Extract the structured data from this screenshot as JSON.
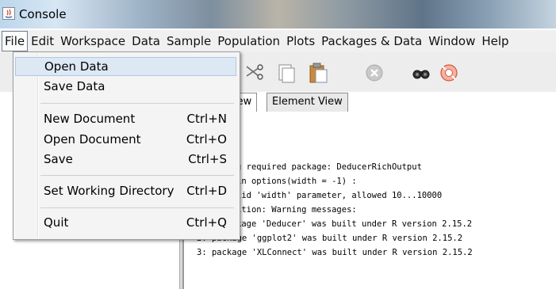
{
  "window": {
    "title": "Console"
  },
  "menubar": {
    "items": [
      "File",
      "Edit",
      "Workspace",
      "Data",
      "Sample",
      "Population",
      "Plots",
      "Packages & Data",
      "Window",
      "Help"
    ]
  },
  "file_menu": {
    "items": [
      {
        "label": "Open Data",
        "shortcut": ""
      },
      {
        "label": "Save Data",
        "shortcut": ""
      },
      {
        "label": "New Document",
        "shortcut": "Ctrl+N"
      },
      {
        "label": "Open Document",
        "shortcut": "Ctrl+O"
      },
      {
        "label": "Save",
        "shortcut": "Ctrl+S"
      },
      {
        "label": "Set Working Directory",
        "shortcut": "Ctrl+D"
      },
      {
        "label": "Quit",
        "shortcut": "Ctrl+Q"
      }
    ]
  },
  "toolbar": {
    "icons": [
      "scissors-icon",
      "copy-icon",
      "paste-icon",
      "stop-icon",
      "find-icon",
      "help-icon"
    ]
  },
  "tabs": [
    {
      "label": "Data View",
      "visible_label": "iew"
    },
    {
      "label": "Element View"
    }
  ],
  "console": {
    "lines": [
      "g required package: DeducerRichOutput",
      "in options(width = -1) :",
      "lid 'width' parameter, allowed 10...10000",
      "ition: Warning messages:",
      "kage 'Deducer' was built under R version 2.15.2",
      "2: package 'ggplot2' was built under R version 2.15.2",
      "3: package 'XLConnect' was built under R version 2.15.2"
    ]
  },
  "colors": {
    "menu_highlight": "#dde8f5",
    "menubar_bg": "#f0f0f0",
    "toolbar_bg": "#ededed"
  }
}
